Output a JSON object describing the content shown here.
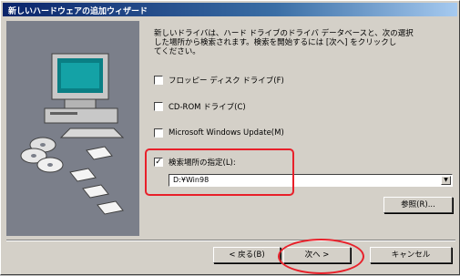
{
  "window": {
    "title": "新しいハードウェアの追加ウィザード"
  },
  "description": "新しいドライバは、ハード ドライブのドライバ データベースと、次の選択\nした場所から検索されます。検索を開始するには [次へ] をクリックし\nてください。",
  "options": [
    {
      "label": "フロッピー ディスク ドライブ(F)",
      "checked": false
    },
    {
      "label": "CD-ROM ドライブ(C)",
      "checked": false
    },
    {
      "label": "Microsoft Windows Update(M)",
      "checked": false
    },
    {
      "label": "検索場所の指定(L):",
      "checked": true
    }
  ],
  "path_combo": {
    "value": "D:¥Win98"
  },
  "buttons": {
    "browse": "参照(R)...",
    "back": "< 戻る(B)",
    "next": "次へ >",
    "cancel": "キャンセル"
  },
  "colors": {
    "title_start": "#0a246a",
    "title_end": "#a6caf0",
    "dialog_bg": "#d4d0c8",
    "annotation": "#e8202a"
  }
}
